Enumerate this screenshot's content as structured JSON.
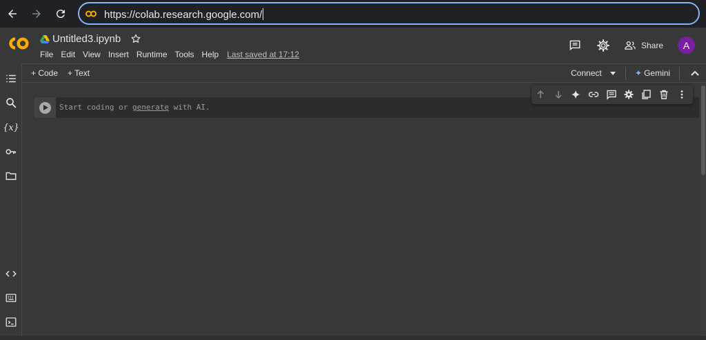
{
  "browser": {
    "url": "https://colab.research.google.com/",
    "icons": [
      "back-arrow-icon",
      "forward-arrow-icon",
      "reload-icon",
      "site-icon"
    ]
  },
  "header": {
    "notebook_title": "Untitled3.ipynb",
    "menu": [
      "File",
      "Edit",
      "View",
      "Insert",
      "Runtime",
      "Tools",
      "Help"
    ],
    "last_saved": "Last saved at 17:12",
    "share_label": "Share",
    "avatar_letter": "A"
  },
  "toolbar": {
    "code_label": "+ Code",
    "text_label": "+ Text",
    "connect_label": "Connect",
    "gemini_label": "Gemini"
  },
  "sidebar": {
    "icons": [
      "table-of-contents-icon",
      "search-icon",
      "variables-icon",
      "secrets-key-icon",
      "files-folder-icon",
      "code-snippets-icon",
      "command-palette-icon",
      "terminal-icon"
    ],
    "variables_glyph": "{x}"
  },
  "cell": {
    "placeholder_start": "Start coding or ",
    "placeholder_link": "generate",
    "placeholder_end": " with AI."
  },
  "colors": {
    "accent_blue": "#8ab4f8",
    "colab_orange": "#f9ab00",
    "avatar_purple": "#7b1fa2",
    "background": "#383838"
  }
}
